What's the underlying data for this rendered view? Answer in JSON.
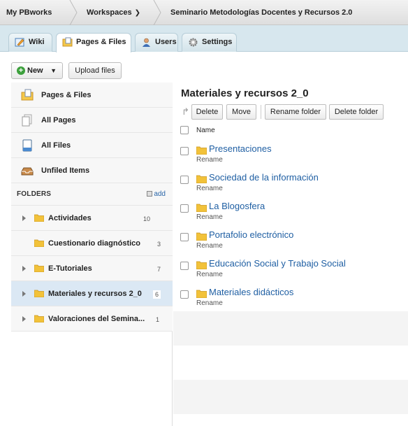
{
  "topbar": {
    "my_pbworks": "My PBworks",
    "workspaces": "Workspaces",
    "workspace_title": "Seminario Metodologías Docentes y Recursos 2.0"
  },
  "tabs": [
    {
      "label": "Wiki",
      "icon": "wiki-icon"
    },
    {
      "label": "Pages & Files",
      "icon": "pages-files-icon"
    },
    {
      "label": "Users",
      "icon": "users-icon"
    },
    {
      "label": "Settings",
      "icon": "settings-icon"
    }
  ],
  "actions": {
    "new_label": "New",
    "upload_label": "Upload files"
  },
  "sidebar": {
    "items": [
      {
        "label": "Pages & Files",
        "icon": "pages-files-icon"
      },
      {
        "label": "All Pages",
        "icon": "pages-icon"
      },
      {
        "label": "All Files",
        "icon": "file-icon"
      },
      {
        "label": "Unfiled Items",
        "icon": "tray-icon"
      }
    ],
    "folders_heading": "FOLDERS",
    "add_label": "add",
    "folders": [
      {
        "label": "Actividades",
        "count": "10",
        "expandable": true,
        "selected": false
      },
      {
        "label": "Cuestionario diagnóstico",
        "count": "3",
        "expandable": false,
        "selected": false
      },
      {
        "label": "E-Tutoriales",
        "count": "7",
        "expandable": true,
        "selected": false
      },
      {
        "label": "Materiales y recursos 2_0",
        "count": "6",
        "expandable": true,
        "selected": true
      },
      {
        "label": "Valoraciones del Semina...",
        "count": "1",
        "expandable": true,
        "selected": false
      }
    ]
  },
  "main": {
    "title": "Materiales y recursos 2_0",
    "buttons": {
      "delete": "Delete",
      "move": "Move",
      "rename_folder": "Rename folder",
      "delete_folder": "Delete folder"
    },
    "column_name": "Name",
    "rename_label": "Rename",
    "items": [
      "Presentaciones",
      "Sociedad de la información",
      "La Blogosfera",
      "Portafolio electrónico",
      "Educación Social y Trabajo Social",
      "Materiales didácticos"
    ]
  },
  "colors": {
    "accent_link": "#1f5fa3",
    "tab_strip": "#d7e7ee",
    "selected_folder": "#dbe8f4",
    "folder_yellow": "#f2c23a"
  }
}
